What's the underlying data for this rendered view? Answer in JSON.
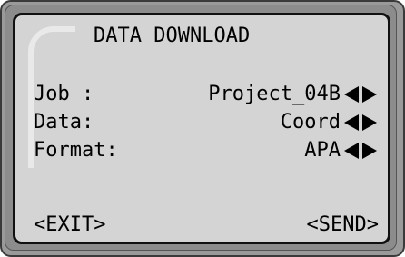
{
  "screen": {
    "title": "DATA DOWNLOAD"
  },
  "fields": [
    {
      "label": "Job :",
      "value": "Project_04B"
    },
    {
      "label": "Data:",
      "value": "Coord"
    },
    {
      "label": "Format:",
      "value": "APA"
    }
  ],
  "softkeys": {
    "left": "<EXIT>",
    "right": "<SEND>"
  },
  "icons": {
    "prev": "triangle-left-icon",
    "next": "triangle-right-icon"
  },
  "colors": {
    "lcd_background": "#d4d4d4",
    "lcd_text": "#000000",
    "bezel": "#9a9a9a"
  }
}
